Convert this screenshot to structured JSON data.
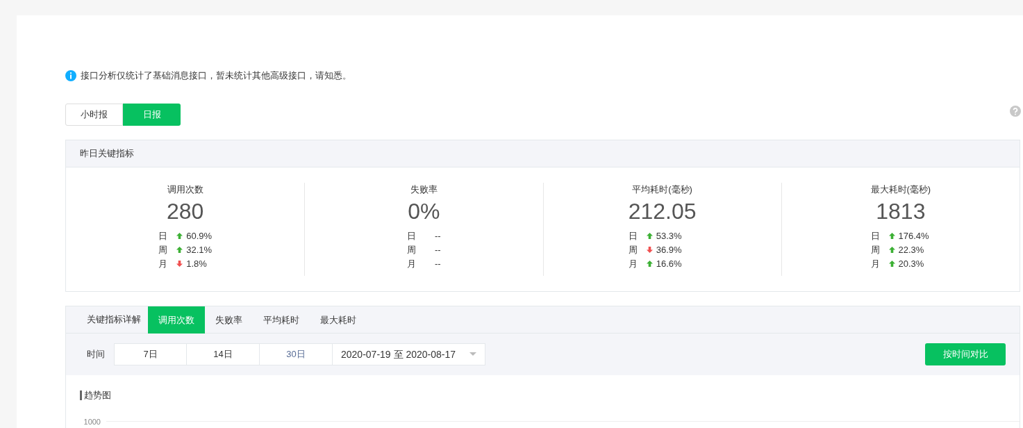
{
  "notice": {
    "text": "接口分析仅统计了基础消息接口，暂未统计其他高级接口，请知悉。"
  },
  "report_tabs": [
    {
      "label": "小时报",
      "selected": false
    },
    {
      "label": "日报",
      "selected": true
    }
  ],
  "key_metrics": {
    "title": "昨日关键指标",
    "metrics": [
      {
        "label": "调用次数",
        "value": "280",
        "changes": [
          {
            "period": "日",
            "kind": "up",
            "value": "60.9%"
          },
          {
            "period": "周",
            "kind": "up",
            "value": "32.1%"
          },
          {
            "period": "月",
            "kind": "down",
            "value": "1.8%"
          }
        ]
      },
      {
        "label": "失败率",
        "value": "0%",
        "changes": [
          {
            "period": "日",
            "kind": "none",
            "value": "--"
          },
          {
            "period": "周",
            "kind": "none",
            "value": "--"
          },
          {
            "period": "月",
            "kind": "none",
            "value": "--"
          }
        ]
      },
      {
        "label": "平均耗时(毫秒)",
        "value": "212.05",
        "changes": [
          {
            "period": "日",
            "kind": "up",
            "value": "53.3%"
          },
          {
            "period": "周",
            "kind": "down",
            "value": "36.9%"
          },
          {
            "period": "月",
            "kind": "up",
            "value": "16.6%"
          }
        ]
      },
      {
        "label": "最大耗时(毫秒)",
        "value": "1813",
        "changes": [
          {
            "period": "日",
            "kind": "up",
            "value": "176.4%"
          },
          {
            "period": "周",
            "kind": "up",
            "value": "22.3%"
          },
          {
            "period": "月",
            "kind": "up",
            "value": "20.3%"
          }
        ]
      }
    ]
  },
  "detail": {
    "title": "关键指标详解",
    "tabs": [
      {
        "label": "调用次数",
        "selected": true
      },
      {
        "label": "失败率",
        "selected": false
      },
      {
        "label": "平均耗时",
        "selected": false
      },
      {
        "label": "最大耗时",
        "selected": false
      }
    ],
    "time_label": "时间",
    "ranges": [
      {
        "label": "7日",
        "selected": false
      },
      {
        "label": "14日",
        "selected": false
      },
      {
        "label": "30日",
        "selected": true
      }
    ],
    "date_range": "2020-07-19 至 2020-08-17",
    "compare_button": "按时间对比",
    "trend_title": "趋势图",
    "axis_tick": "1000"
  }
}
